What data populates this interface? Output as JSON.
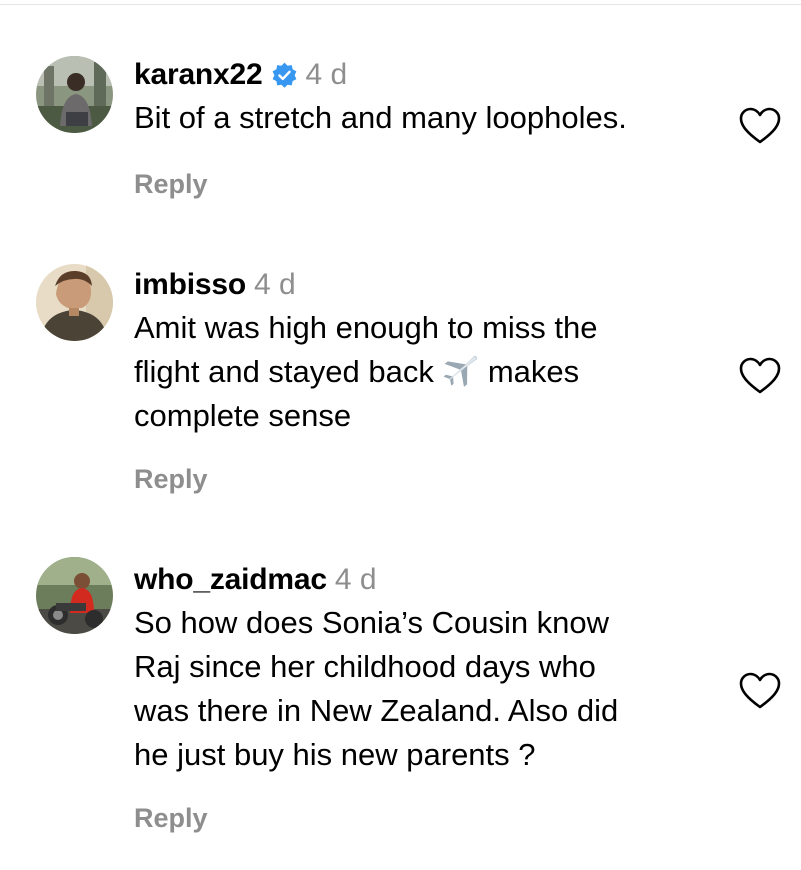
{
  "comments": [
    {
      "username": "karanx22",
      "verified": true,
      "time": "4 d",
      "text_lines": [
        "Bit of a stretch and many loopholes."
      ],
      "reply_label": "Reply",
      "like_icon": "heart-outline-icon"
    },
    {
      "username": "imbisso",
      "verified": false,
      "time": "4 d",
      "text_lines": [
        "Amit was high enough to miss the",
        "flight and stayed back",
        "makes",
        "complete sense"
      ],
      "emoji": "airplane-emoji",
      "reply_label": "Reply",
      "like_icon": "heart-outline-icon"
    },
    {
      "username": "who_zaidmac",
      "verified": false,
      "time": "4 d",
      "text_lines": [
        "So how does Sonia’s Cousin know",
        "Raj since her childhood days who",
        "was there in New Zealand. Also did",
        "he just buy his new parents ?"
      ],
      "reply_label": "Reply",
      "like_icon": "heart-outline-icon"
    }
  ],
  "colors": {
    "text": "#000000",
    "secondary": "#8e8e8e",
    "verified_badge": "#3897f0",
    "divider": "#e6e6e6"
  }
}
